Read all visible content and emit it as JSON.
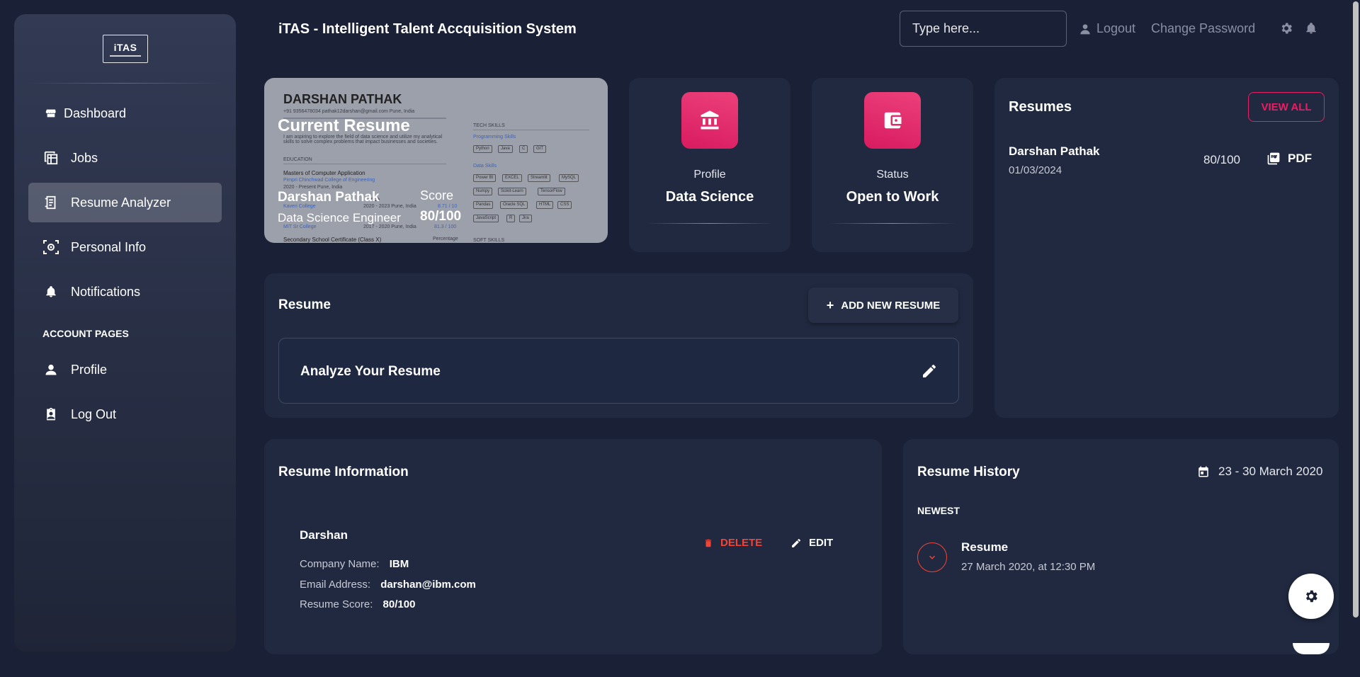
{
  "sidebar": {
    "logo_text": "iTAS",
    "items": [
      {
        "label": "Dashboard",
        "icon": "storefront-icon"
      },
      {
        "label": "Jobs",
        "icon": "table-icon"
      },
      {
        "label": "Resume Analyzer",
        "icon": "receipt-icon",
        "active": true
      },
      {
        "label": "Personal Info",
        "icon": "settings-scan-icon"
      },
      {
        "label": "Notifications",
        "icon": "bell-icon"
      }
    ],
    "section_title": "ACCOUNT PAGES",
    "account_items": [
      {
        "label": "Profile",
        "icon": "person-icon"
      },
      {
        "label": "Log Out",
        "icon": "assignment-icon"
      }
    ]
  },
  "header": {
    "title": "iTAS - Intelligent Talent Accquisition System",
    "search_placeholder": "Type here...",
    "logout_label": "Logout",
    "change_password_label": "Change Password"
  },
  "current_resume": {
    "overlay_title": "Current Resume",
    "name": "Darshan Pathak",
    "role": "Data Science Engineer",
    "score_label": "Score",
    "score_value": "80/100",
    "preview": {
      "name": "DARSHAN PATHAK",
      "contact": "+91 9356478034    pathak12darshan@gmail.com    Pune, India",
      "summary": "I am aspiring to explore the field of data science and utilize my analytical skills to solve complex problems that impact businesses and societies.",
      "education_heading": "EDUCATION",
      "degree": "Masters of Computer Application",
      "college": "Pimpri Chinchwad College of Engineering",
      "dates": "2020 - Present    Pune, India",
      "degree2_tail": "nce",
      "college2": "Kaveri College",
      "dates2": "2020 - 2023    Pune, India",
      "grade2": "8.71 / 10",
      "college3": "MIT Sr College",
      "dates3": "2017 - 2020    Pune, India",
      "grade3": "81.3 / 100",
      "school": "Secondary School Certificate (Class X)",
      "school_tail": "Percentage",
      "tech_heading": "TECH SKILLS",
      "prog_heading": "Programming Skills",
      "prog_chips": [
        "Python",
        "Java",
        "C",
        "GIT"
      ],
      "data_heading": "Data Skills",
      "data_chips_1": [
        "Power BI",
        "EXCEL",
        "Streamlit",
        "MySQL"
      ],
      "data_chips_2": [
        "Numpy",
        "Scikit-Learn",
        "TensorFlow"
      ],
      "data_chips_3": [
        "Pandas",
        "Oracle SQL",
        "HTML",
        "CSS"
      ],
      "data_chips_4": [
        "JavaScript",
        "R",
        "Jira"
      ],
      "soft_heading": "SOFT SKILLS"
    }
  },
  "profile_card": {
    "label": "Profile",
    "value": "Data Science",
    "icon": "bank-icon"
  },
  "status_card": {
    "label": "Status",
    "value": "Open to Work",
    "icon": "wallet-icon"
  },
  "resumes_panel": {
    "title": "Resumes",
    "view_all_label": "VIEW ALL",
    "items": [
      {
        "name": "Darshan Pathak",
        "date": "01/03/2024",
        "score": "80/100",
        "file_label": "PDF"
      }
    ]
  },
  "resume_section": {
    "title": "Resume",
    "add_button": "ADD NEW RESUME",
    "analyze_label": "Analyze Your Resume"
  },
  "resume_information": {
    "title": "Resume Information",
    "entry": {
      "name": "Darshan",
      "company_label": "Company Name:",
      "company_value": "IBM",
      "email_label": "Email Address:",
      "email_value": "darshan@ibm.com",
      "score_label": "Resume Score:",
      "score_value": "80/100",
      "delete_label": "DELETE",
      "edit_label": "EDIT"
    }
  },
  "resume_history": {
    "title": "Resume History",
    "date_range": "23 - 30 March 2020",
    "group_label": "NEWEST",
    "items": [
      {
        "title": "Resume",
        "time": "27 March 2020, at 12:30 PM"
      }
    ]
  },
  "colors": {
    "background": "#1a2035",
    "card": "#202940",
    "accent": "#e91e63",
    "danger": "#f44335"
  }
}
